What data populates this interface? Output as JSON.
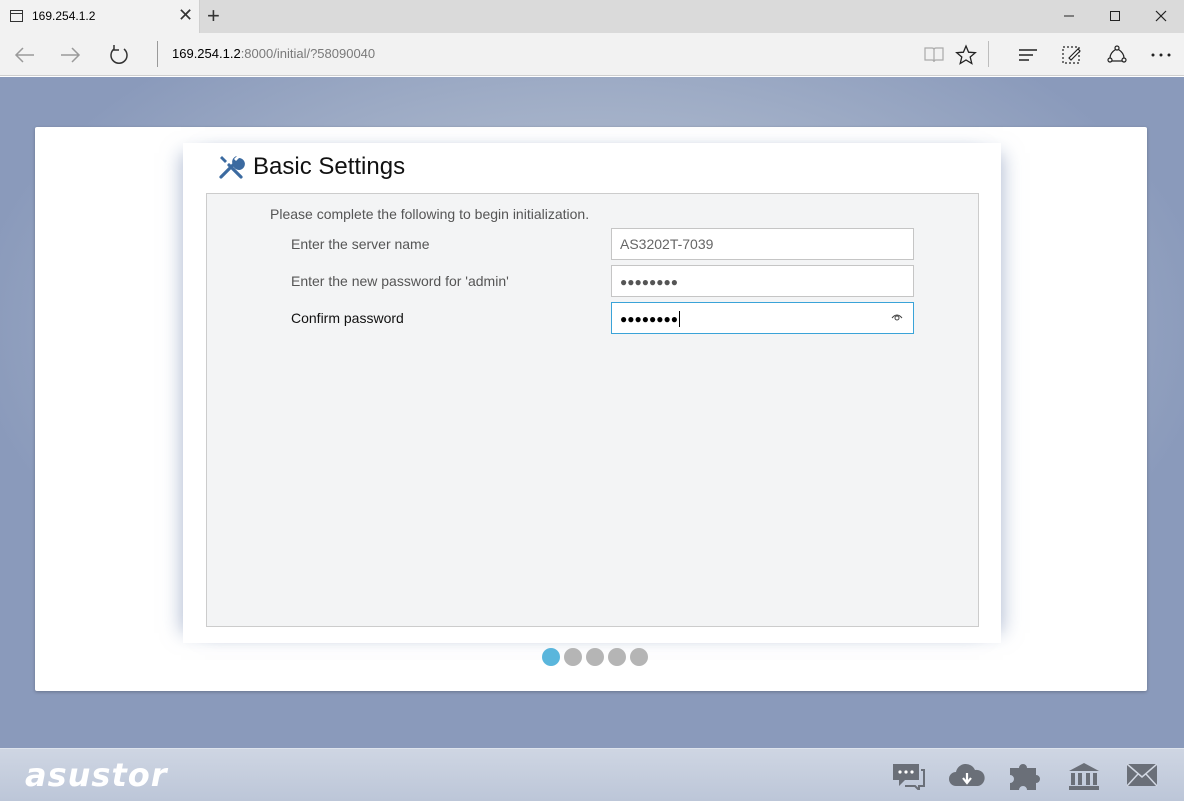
{
  "browser": {
    "tab_title": "169.254.1.2",
    "tab_close": "✕",
    "new_tab": "+",
    "address_host": "169.254.1.2",
    "address_rest": ":8000/initial/?58090040"
  },
  "page": {
    "title": "Basic Settings",
    "intro": "Please complete the following to begin initialization.",
    "fields": [
      {
        "label": "Enter the server name",
        "value": "AS3202T-7039"
      },
      {
        "label": "Enter the new password for 'admin'",
        "value": "●●●●●●●●"
      },
      {
        "label": "Confirm password",
        "value": "●●●●●●●●"
      }
    ],
    "pager": {
      "total": 5,
      "current": 1
    },
    "accent_color": "#5ab6dc"
  },
  "footer": {
    "logo": "asustor",
    "icons": [
      "chat-icon",
      "cloud-download-icon",
      "puzzle-icon",
      "bank-icon",
      "mail-icon"
    ]
  }
}
